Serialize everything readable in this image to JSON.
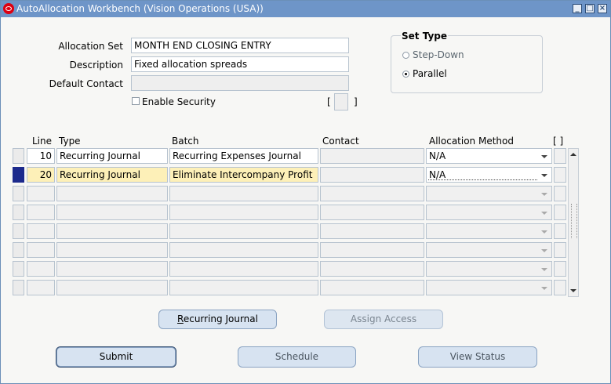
{
  "window": {
    "title": "AutoAllocation Workbench (Vision Operations (USA))",
    "minimize": "▬",
    "maximize": "□",
    "close": "✕"
  },
  "header": {
    "allocation_set_label": "Allocation Set",
    "allocation_set_value": "MONTH END CLOSING ENTRY",
    "description_label": "Description",
    "description_value": "Fixed allocation spreads",
    "default_contact_label": "Default Contact",
    "default_contact_value": "",
    "enable_security_label": "Enable Security",
    "enable_security_checked": false,
    "bracket_left": "[",
    "bracket_right": "]"
  },
  "set_type": {
    "title": "Set Type",
    "options": [
      {
        "label": "Step-Down",
        "selected": false
      },
      {
        "label": "Parallel",
        "selected": true
      }
    ]
  },
  "table": {
    "columns": {
      "line": "Line",
      "type": "Type",
      "batch": "Batch",
      "contact": "Contact",
      "allocation_method": "Allocation Method",
      "flex": "[ ]"
    },
    "rows": [
      {
        "line": "10",
        "type": "Recurring Journal",
        "batch": "Recurring Expenses Journal",
        "contact": "",
        "method": "N/A",
        "current": false
      },
      {
        "line": "20",
        "type": "Recurring Journal",
        "batch": "Eliminate Intercompany Profit",
        "contact": "",
        "method": "N/A",
        "current": true
      },
      {
        "line": "",
        "type": "",
        "batch": "",
        "contact": "",
        "method": "",
        "current": false
      },
      {
        "line": "",
        "type": "",
        "batch": "",
        "contact": "",
        "method": "",
        "current": false
      },
      {
        "line": "",
        "type": "",
        "batch": "",
        "contact": "",
        "method": "",
        "current": false
      },
      {
        "line": "",
        "type": "",
        "batch": "",
        "contact": "",
        "method": "",
        "current": false
      },
      {
        "line": "",
        "type": "",
        "batch": "",
        "contact": "",
        "method": "",
        "current": false
      },
      {
        "line": "",
        "type": "",
        "batch": "",
        "contact": "",
        "method": "",
        "current": false
      }
    ]
  },
  "buttons": {
    "recurring_journal": "Recurring Journal",
    "assign_access": "Assign Access",
    "submit": "Submit",
    "schedule": "Schedule",
    "view_status": "View Status"
  },
  "colors": {
    "titlebar": "#6e95c8",
    "current_row": "#fdf0b8",
    "row_indicator": "#1c2a8c"
  }
}
